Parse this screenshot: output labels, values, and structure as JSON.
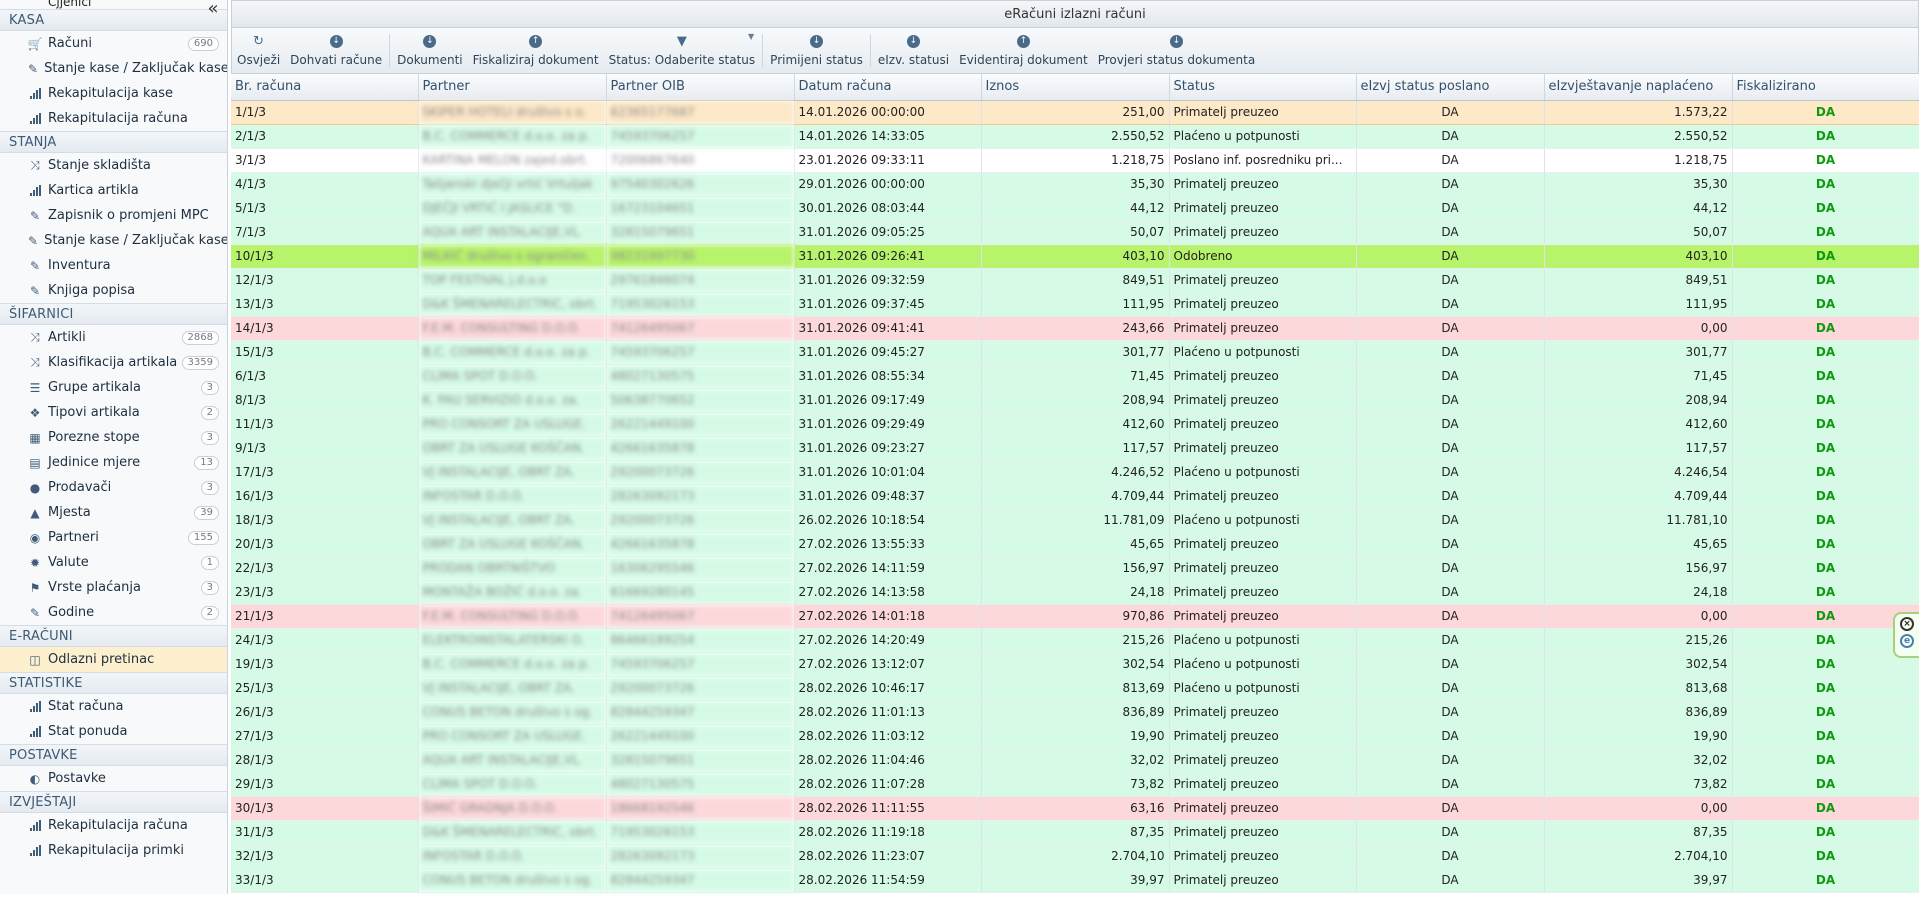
{
  "sidebar": {
    "collapse_label": "«",
    "partial_item": "Cjjenici",
    "sections": [
      {
        "title": "KASA",
        "items": [
          {
            "label": "Računi",
            "icon": "cart-icon",
            "badge": "690"
          },
          {
            "label": "Stanje kase / Zaključak kase",
            "icon": "edit-icon",
            "badge": ""
          },
          {
            "label": "Rekapitulacija kase",
            "icon": "bar-chart-icon",
            "badge": ""
          },
          {
            "label": "Rekapitulacija računa",
            "icon": "bar-chart-icon",
            "badge": ""
          }
        ]
      },
      {
        "title": "STANJA",
        "items": [
          {
            "label": "Stanje skladišta",
            "icon": "shuffle-icon",
            "badge": ""
          },
          {
            "label": "Kartica artikla",
            "icon": "bar-chart-icon",
            "badge": ""
          },
          {
            "label": "Zapisnik o promjeni MPC",
            "icon": "edit-icon",
            "badge": ""
          },
          {
            "label": "Stanje kase / Zaključak kase",
            "icon": "edit-icon",
            "badge": ""
          },
          {
            "label": "Inventura",
            "icon": "edit-icon",
            "badge": ""
          },
          {
            "label": "Knjiga popisa",
            "icon": "edit-icon",
            "badge": ""
          }
        ]
      },
      {
        "title": "ŠIFARNICI",
        "items": [
          {
            "label": "Artikli",
            "icon": "shuffle-icon",
            "badge": "2868"
          },
          {
            "label": "Klasifikacija artikala",
            "icon": "shuffle-icon",
            "badge": "3359"
          },
          {
            "label": "Grupe artikala",
            "icon": "list-icon",
            "badge": "3"
          },
          {
            "label": "Tipovi artikala",
            "icon": "tags-icon",
            "badge": "2"
          },
          {
            "label": "Porezne stope",
            "icon": "grid-icon",
            "badge": "3"
          },
          {
            "label": "Jedinice mjere",
            "icon": "book-icon",
            "badge": "13"
          },
          {
            "label": "Prodavači",
            "icon": "user-icon",
            "badge": "3"
          },
          {
            "label": "Mjesta",
            "icon": "road-icon",
            "badge": "39"
          },
          {
            "label": "Partneri",
            "icon": "partner-icon",
            "badge": "155"
          },
          {
            "label": "Valute",
            "icon": "gear-icon",
            "badge": "1"
          },
          {
            "label": "Vrste plaćanja",
            "icon": "flag-icon",
            "badge": "3"
          },
          {
            "label": "Godine",
            "icon": "edit-icon",
            "badge": "2"
          }
        ]
      },
      {
        "title": "E-RAČUNI",
        "items": [
          {
            "label": "Odlazni pretinac",
            "icon": "inbox-icon",
            "badge": "",
            "active": true
          }
        ]
      },
      {
        "title": "STATISTIKE",
        "items": [
          {
            "label": "Stat računa",
            "icon": "bar-chart-icon",
            "badge": ""
          },
          {
            "label": "Stat ponuda",
            "icon": "bar-chart-icon",
            "badge": ""
          }
        ]
      },
      {
        "title": "POSTAVKE",
        "items": [
          {
            "label": "Postavke",
            "icon": "contrast-icon",
            "badge": ""
          }
        ]
      },
      {
        "title": "IZVJEŠTAJI",
        "items": [
          {
            "label": "Rekapitulacija računa",
            "icon": "bar-chart-icon",
            "badge": ""
          },
          {
            "label": "Rekapitulacija primki",
            "icon": "bar-chart-icon",
            "badge": ""
          }
        ]
      }
    ]
  },
  "panel": {
    "title": "eRačuni izlazni računi"
  },
  "toolbar": {
    "buttons": [
      {
        "label": "Osvježi",
        "icon": "refresh-icon"
      },
      {
        "label": "Dohvati račune",
        "icon": "download-icon"
      },
      {
        "label": "Dokumenti",
        "icon": "download-icon"
      },
      {
        "label": "Fiskaliziraj dokument",
        "icon": "upload-icon"
      },
      {
        "label": "Status: Odaberite status",
        "icon": "filter-icon",
        "dropdown": true
      },
      {
        "label": "Primijeni status",
        "icon": "download-icon"
      },
      {
        "label": "eIzv. statusi",
        "icon": "download-icon"
      },
      {
        "label": "Evidentiraj dokument",
        "icon": "upload-icon"
      },
      {
        "label": "Provjeri status dokumenta",
        "icon": "download-icon"
      }
    ]
  },
  "table": {
    "columns": [
      "Br. računa",
      "Partner",
      "Partner OIB",
      "Datum računa",
      "Iznos",
      "Status",
      "eIzvj status poslano",
      "eIzvještavanje naplaćeno",
      "Fiskalizirano"
    ],
    "rows": [
      {
        "br": "1/1/3",
        "partner": "SKIPER HOTELI društvo s o.",
        "oib": "62365177687",
        "datum": "14.01.2026 00:00:00",
        "iznos": "251,00",
        "status": "Primatelj preuzeo",
        "poslano": "DA",
        "naplaceno": "1.573,22",
        "fisk": "DA",
        "state": "sel"
      },
      {
        "br": "2/1/3",
        "partner": "B.C. COMMERCE d.o.o. za p.",
        "oib": "74593706257",
        "datum": "14.01.2026 14:33:05",
        "iznos": "2.550,52",
        "status": "Plaćeno u potpunosti",
        "poslano": "DA",
        "naplaceno": "2.550,52",
        "fisk": "DA",
        "state": "ok"
      },
      {
        "br": "3/1/3",
        "partner": "KARTINA MELON zajed.obrt.",
        "oib": "72006867640",
        "datum": "23.01.2026 09:33:11",
        "iznos": "1.218,75",
        "status": "Poslano inf. posredniku pri...",
        "poslano": "DA",
        "naplaceno": "1.218,75",
        "fisk": "DA",
        "state": "plain"
      },
      {
        "br": "4/1/3",
        "partner": "Talijanski dječji vrtić Vrtuljak",
        "oib": "97540302626",
        "datum": "29.01.2026 00:00:00",
        "iznos": "35,30",
        "status": "Primatelj preuzeo",
        "poslano": "DA",
        "naplaceno": "35,30",
        "fisk": "DA",
        "state": "ok"
      },
      {
        "br": "5/1/3",
        "partner": "DJEČJI VRTIĆ I JASLICE \"D.",
        "oib": "16723104651",
        "datum": "30.01.2026 08:03:44",
        "iznos": "44,12",
        "status": "Primatelj preuzeo",
        "poslano": "DA",
        "naplaceno": "44,12",
        "fisk": "DA",
        "state": "ok"
      },
      {
        "br": "7/1/3",
        "partner": "AQUA ART INSTALACIJE,VL.",
        "oib": "32815079651",
        "datum": "31.01.2026 09:05:25",
        "iznos": "50,07",
        "status": "Primatelj preuzeo",
        "poslano": "DA",
        "naplaceno": "50,07",
        "fisk": "DA",
        "state": "ok"
      },
      {
        "br": "10/1/3",
        "partner": "MILKIĆ društvo s ograničen.",
        "oib": "98231997730",
        "datum": "31.01.2026 09:26:41",
        "iznos": "403,10",
        "status": "Odobreno",
        "poslano": "DA",
        "naplaceno": "403,10",
        "fisk": "DA",
        "state": "hl"
      },
      {
        "br": "12/1/3",
        "partner": "TOP FESTIVAL j.d.o.o",
        "oib": "29761846074",
        "datum": "31.01.2026 09:32:59",
        "iznos": "849,51",
        "status": "Primatelj preuzeo",
        "poslano": "DA",
        "naplaceno": "849,51",
        "fisk": "DA",
        "state": "ok"
      },
      {
        "br": "13/1/3",
        "partner": "D&K ŠMENARELECTRIC, obrt.",
        "oib": "71953026153",
        "datum": "31.01.2026 09:37:45",
        "iznos": "111,95",
        "status": "Primatelj preuzeo",
        "poslano": "DA",
        "naplaceno": "111,95",
        "fisk": "DA",
        "state": "ok"
      },
      {
        "br": "14/1/3",
        "partner": "F.E.M. CONSULTING D.O.O.",
        "oib": "74126495067",
        "datum": "31.01.2026 09:41:41",
        "iznos": "243,66",
        "status": "Primatelj preuzeo",
        "poslano": "DA",
        "naplaceno": "0,00",
        "fisk": "DA",
        "state": "bad"
      },
      {
        "br": "15/1/3",
        "partner": "B.C. COMMERCE d.o.o. za p.",
        "oib": "74593706257",
        "datum": "31.01.2026 09:45:27",
        "iznos": "301,77",
        "status": "Plaćeno u potpunosti",
        "poslano": "DA",
        "naplaceno": "301,77",
        "fisk": "DA",
        "state": "ok"
      },
      {
        "br": "6/1/3",
        "partner": "CLIMA SPOT D.O.O.",
        "oib": "48027130575",
        "datum": "31.01.2026 08:55:34",
        "iznos": "71,45",
        "status": "Primatelj preuzeo",
        "poslano": "DA",
        "naplaceno": "71,45",
        "fisk": "DA",
        "state": "ok"
      },
      {
        "br": "8/1/3",
        "partner": "K. PAU SERVIZIO d.o.o. za.",
        "oib": "50638770652",
        "datum": "31.01.2026 09:17:49",
        "iznos": "208,94",
        "status": "Primatelj preuzeo",
        "poslano": "DA",
        "naplaceno": "208,94",
        "fisk": "DA",
        "state": "ok"
      },
      {
        "br": "11/1/3",
        "partner": "PRO CONSORT ZA USLUGE.",
        "oib": "26221449100",
        "datum": "31.01.2026 09:29:49",
        "iznos": "412,60",
        "status": "Primatelj preuzeo",
        "poslano": "DA",
        "naplaceno": "412,60",
        "fisk": "DA",
        "state": "ok"
      },
      {
        "br": "9/1/3",
        "partner": "OBRT ZA USLUGE KOŠČAN.",
        "oib": "42661635878",
        "datum": "31.01.2026 09:23:27",
        "iznos": "117,57",
        "status": "Primatelj preuzeo",
        "poslano": "DA",
        "naplaceno": "117,57",
        "fisk": "DA",
        "state": "ok"
      },
      {
        "br": "17/1/3",
        "partner": "VJ INSTALACIJE, OBRT ZA.",
        "oib": "29200073726",
        "datum": "31.01.2026 10:01:04",
        "iznos": "4.246,52",
        "status": "Plaćeno u potpunosti",
        "poslano": "DA",
        "naplaceno": "4.246,54",
        "fisk": "DA",
        "state": "ok"
      },
      {
        "br": "16/1/3",
        "partner": "INFOSTAR D.O.O.",
        "oib": "28263092173",
        "datum": "31.01.2026 09:48:37",
        "iznos": "4.709,44",
        "status": "Primatelj preuzeo",
        "poslano": "DA",
        "naplaceno": "4.709,44",
        "fisk": "DA",
        "state": "ok"
      },
      {
        "br": "18/1/3",
        "partner": "VJ INSTALACIJE, OBRT ZA.",
        "oib": "29200073726",
        "datum": "26.02.2026 10:18:54",
        "iznos": "11.781,09",
        "status": "Plaćeno u potpunosti",
        "poslano": "DA",
        "naplaceno": "11.781,10",
        "fisk": "DA",
        "state": "ok"
      },
      {
        "br": "20/1/3",
        "partner": "OBRT ZA USLUGE KOŠČAN.",
        "oib": "42661635878",
        "datum": "27.02.2026 13:55:33",
        "iznos": "45,65",
        "status": "Primatelj preuzeo",
        "poslano": "DA",
        "naplaceno": "45,65",
        "fisk": "DA",
        "state": "ok"
      },
      {
        "br": "22/1/3",
        "partner": "PRODAN OBRTNIŠTVO",
        "oib": "16306295546",
        "datum": "27.02.2026 14:11:59",
        "iznos": "156,97",
        "status": "Primatelj preuzeo",
        "poslano": "DA",
        "naplaceno": "156,97",
        "fisk": "DA",
        "state": "ok"
      },
      {
        "br": "23/1/3",
        "partner": "MONTAŽA BOŽIĆ d.o.o. za.",
        "oib": "61669280145",
        "datum": "27.02.2026 14:13:58",
        "iznos": "24,18",
        "status": "Primatelj preuzeo",
        "poslano": "DA",
        "naplaceno": "24,18",
        "fisk": "DA",
        "state": "ok"
      },
      {
        "br": "21/1/3",
        "partner": "F.E.M. CONSULTING D.O.O.",
        "oib": "74126495067",
        "datum": "27.02.2026 14:01:18",
        "iznos": "970,86",
        "status": "Primatelj preuzeo",
        "poslano": "DA",
        "naplaceno": "0,00",
        "fisk": "DA",
        "state": "bad"
      },
      {
        "br": "24/1/3",
        "partner": "ELEKTROINSTALATERSKI O.",
        "oib": "86466189254",
        "datum": "27.02.2026 14:20:49",
        "iznos": "215,26",
        "status": "Plaćeno u potpunosti",
        "poslano": "DA",
        "naplaceno": "215,26",
        "fisk": "DA",
        "state": "ok"
      },
      {
        "br": "19/1/3",
        "partner": "B.C. COMMERCE d.o.o. za p.",
        "oib": "74593706257",
        "datum": "27.02.2026 13:12:07",
        "iznos": "302,54",
        "status": "Plaćeno u potpunosti",
        "poslano": "DA",
        "naplaceno": "302,54",
        "fisk": "DA",
        "state": "ok"
      },
      {
        "br": "25/1/3",
        "partner": "VJ INSTALACIJE, OBRT ZA.",
        "oib": "29200073726",
        "datum": "28.02.2026 10:46:17",
        "iznos": "813,69",
        "status": "Plaćeno u potpunosti",
        "poslano": "DA",
        "naplaceno": "813,68",
        "fisk": "DA",
        "state": "ok"
      },
      {
        "br": "26/1/3",
        "partner": "CONUS BETON društvo s og.",
        "oib": "82844259347",
        "datum": "28.02.2026 11:01:13",
        "iznos": "836,89",
        "status": "Primatelj preuzeo",
        "poslano": "DA",
        "naplaceno": "836,89",
        "fisk": "DA",
        "state": "ok"
      },
      {
        "br": "27/1/3",
        "partner": "PRO CONSORT ZA USLUGE.",
        "oib": "26221449100",
        "datum": "28.02.2026 11:03:12",
        "iznos": "19,90",
        "status": "Primatelj preuzeo",
        "poslano": "DA",
        "naplaceno": "19,90",
        "fisk": "DA",
        "state": "ok"
      },
      {
        "br": "28/1/3",
        "partner": "AQUA ART INSTALACIJE,VL.",
        "oib": "32815079651",
        "datum": "28.02.2026 11:04:46",
        "iznos": "32,02",
        "status": "Primatelj preuzeo",
        "poslano": "DA",
        "naplaceno": "32,02",
        "fisk": "DA",
        "state": "ok"
      },
      {
        "br": "29/1/3",
        "partner": "CLIMA SPOT D.O.O.",
        "oib": "48027130575",
        "datum": "28.02.2026 11:07:28",
        "iznos": "73,82",
        "status": "Primatelj preuzeo",
        "poslano": "DA",
        "naplaceno": "73,82",
        "fisk": "DA",
        "state": "ok"
      },
      {
        "br": "30/1/3",
        "partner": "ŠIMIĆ GRADNJA D.O.O.",
        "oib": "18668192546",
        "datum": "28.02.2026 11:11:55",
        "iznos": "63,16",
        "status": "Primatelj preuzeo",
        "poslano": "DA",
        "naplaceno": "0,00",
        "fisk": "DA",
        "state": "bad"
      },
      {
        "br": "31/1/3",
        "partner": "D&K ŠMENARELECTRIC, obrt.",
        "oib": "71953026153",
        "datum": "28.02.2026 11:19:18",
        "iznos": "87,35",
        "status": "Primatelj preuzeo",
        "poslano": "DA",
        "naplaceno": "87,35",
        "fisk": "DA",
        "state": "ok"
      },
      {
        "br": "32/1/3",
        "partner": "INFOSTAR D.O.O.",
        "oib": "28263092173",
        "datum": "28.02.2026 11:23:07",
        "iznos": "2.704,10",
        "status": "Primatelj preuzeo",
        "poslano": "DA",
        "naplaceno": "2.704,10",
        "fisk": "DA",
        "state": "ok"
      },
      {
        "br": "33/1/3",
        "partner": "CONUS BETON društvo s og.",
        "oib": "82844259347",
        "datum": "28.02.2026 11:54:59",
        "iznos": "39,97",
        "status": "Primatelj preuzeo",
        "poslano": "DA",
        "naplaceno": "39,97",
        "fisk": "DA",
        "state": "ok"
      }
    ]
  },
  "widget": {
    "close_label": "×",
    "e_label": "e"
  },
  "colors": {
    "row_selected": "#fde8c7",
    "row_ok": "#d5fbe7",
    "row_bad": "#fdd8db",
    "row_highlight": "#b7f36b",
    "fiskalizirano_da": "#0e9a0e"
  }
}
